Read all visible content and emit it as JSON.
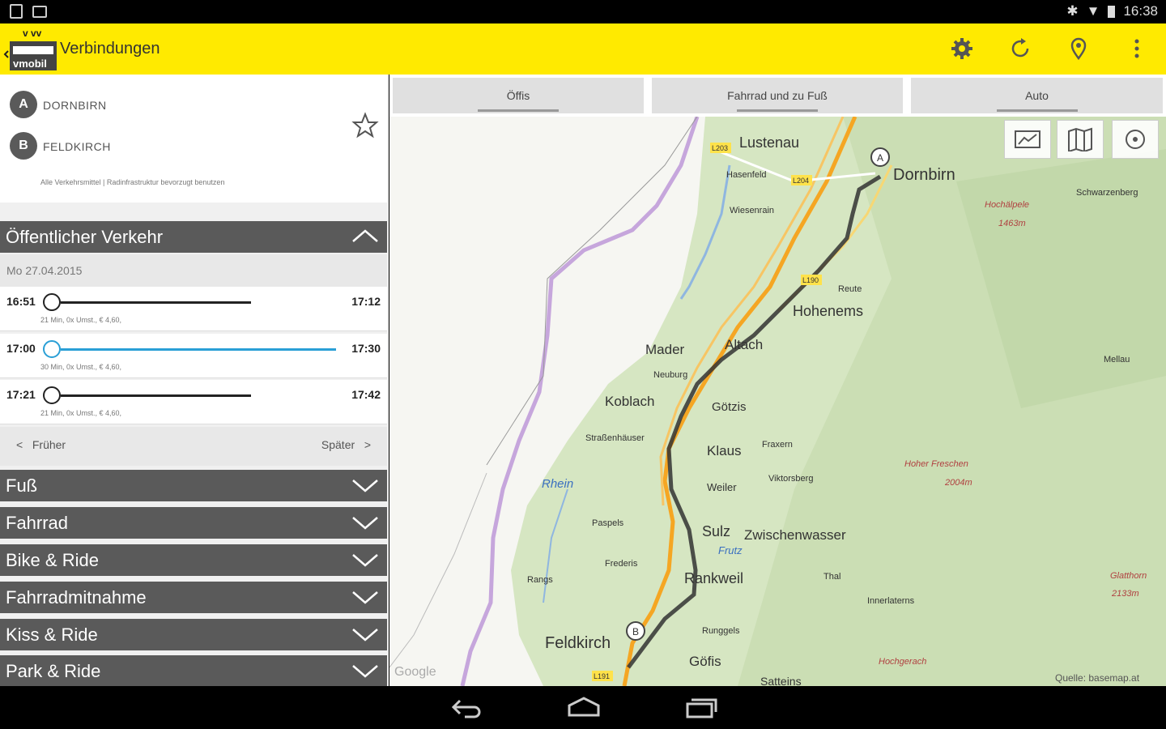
{
  "status_bar": {
    "time": "16:38"
  },
  "app_bar": {
    "logo_text": "vmobil",
    "title": "Verbindungen",
    "icons": [
      "gear-icon",
      "refresh-icon",
      "location-pin-icon",
      "overflow-menu-icon"
    ]
  },
  "route": {
    "from_marker": "A",
    "from": "DORNBIRN",
    "to_marker": "B",
    "to": "FELDKIRCH",
    "note": "Alle Verkehrsmittel | Radinfrastruktur bevorzugt benutzen"
  },
  "sections": {
    "public": "Öffentlicher Verkehr",
    "foot": "Fuß",
    "bike": "Fahrrad",
    "bike_ride": "Bike & Ride",
    "bike_take": "Fahrradmitnahme",
    "kiss_ride": "Kiss & Ride",
    "park_ride": "Park & Ride"
  },
  "date": "Mo 27.04.2015",
  "connections": [
    {
      "dep": "16:51",
      "arr": "17:12",
      "info": "21 Min, 0x Umst., € 4,60,",
      "type": "train",
      "color": "#222222"
    },
    {
      "dep": "17:00",
      "arr": "17:30",
      "info": "30 Min, 0x Umst., € 4,60,",
      "type": "s-bahn",
      "color": "#2a9fd6"
    },
    {
      "dep": "17:21",
      "arr": "17:42",
      "info": "21 Min, 0x Umst., € 4,60,",
      "type": "train",
      "color": "#222222"
    }
  ],
  "pager": {
    "prev": "Früher",
    "next": "Später"
  },
  "tabs": [
    "Öffis",
    "Fahrrad und zu Fuß",
    "Auto"
  ],
  "map": {
    "places": {
      "lustenau": "Lustenau",
      "dornbirn": "Dornbirn",
      "hasenfeld": "Hasenfeld",
      "wiesenrain": "Wiesenrain",
      "schwarzenberg": "Schwarzenberg",
      "hochaelpele": "Hochälpele",
      "hochaelpele_alt": "1463m",
      "reute": "Reute",
      "hohenems": "Hohenems",
      "mader": "Mader",
      "altach": "Altach",
      "neuburg": "Neuburg",
      "koblach": "Koblach",
      "goetzis": "Götzis",
      "mellau": "Mellau",
      "strassenhaeuser": "Straßenhäuser",
      "klaus": "Klaus",
      "fraxern": "Fraxern",
      "hoher_freschen": "Hoher Freschen",
      "hoher_freschen_alt": "2004m",
      "rhein": "Rhein",
      "weiler": "Weiler",
      "viktorsberg": "Viktorsberg",
      "paspels": "Paspels",
      "sulz": "Sulz",
      "zwischenwasser": "Zwischenwasser",
      "frutz": "Frutz",
      "fraederis": "Frederis",
      "rankweil": "Rankweil",
      "thal": "Thal",
      "ruggell": "Rangs",
      "innerlaterns": "Innerlaterns",
      "glatthorn": "Glatthorn",
      "glatthorn_alt": "2133m",
      "runggels": "Runggels",
      "feldkirch": "Feldkirch",
      "goefis": "Göfis",
      "hochgerach": "Hochgerach",
      "satteins": "Satteins",
      "gugle": "Google",
      "source": "Quelle: basemap.at"
    },
    "roads": {
      "l203": "L203",
      "l204": "L204",
      "l190": "L190",
      "l191": "L191"
    },
    "controls": [
      "satellite-view-icon",
      "map-view-icon",
      "my-location-icon"
    ]
  }
}
